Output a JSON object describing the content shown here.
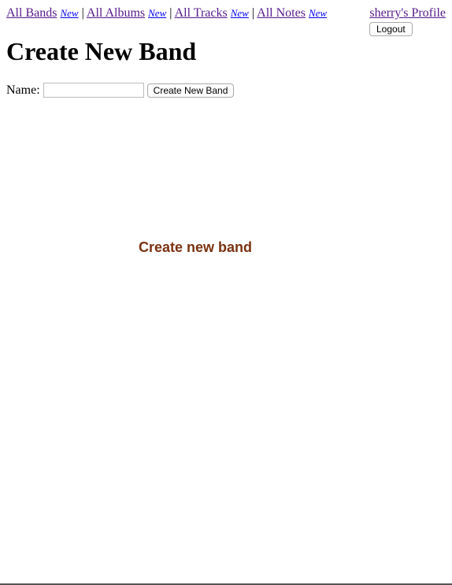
{
  "nav": {
    "bands_label": "All Bands",
    "bands_new": "New",
    "albums_label": "All Albums",
    "albums_new": "New",
    "tracks_label": "All Tracks",
    "tracks_new": "New",
    "notes_label": "All Notes",
    "notes_new": "New",
    "separator": "|"
  },
  "profile": {
    "link": "sherry's Profile",
    "logout_label": "Logout"
  },
  "page": {
    "title": "Create New Band"
  },
  "form": {
    "name_label": "Name:",
    "name_value": "",
    "submit_label": "Create New Band"
  },
  "banner": {
    "text": "Create new band"
  }
}
